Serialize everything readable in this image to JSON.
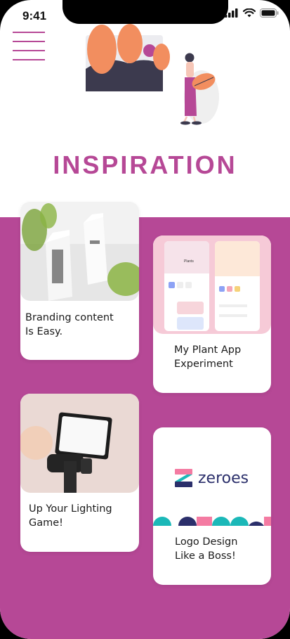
{
  "status_bar": {
    "time": "9:41"
  },
  "header": {
    "title": "INSPIRATION"
  },
  "cards": [
    {
      "label": "Branding content\nIs Easy."
    },
    {
      "label": "My Plant App\nExperiment"
    },
    {
      "label": "Up Your Lighting\nGame!"
    },
    {
      "label": "Logo Design\nLike a Boss!",
      "logo_text": "zeroes"
    }
  ],
  "plant_app_preview": {
    "title": "Plants"
  },
  "colors": {
    "accent": "#b64896",
    "logo_teal": "#1bb8b8",
    "logo_navy": "#2b2f6b"
  }
}
